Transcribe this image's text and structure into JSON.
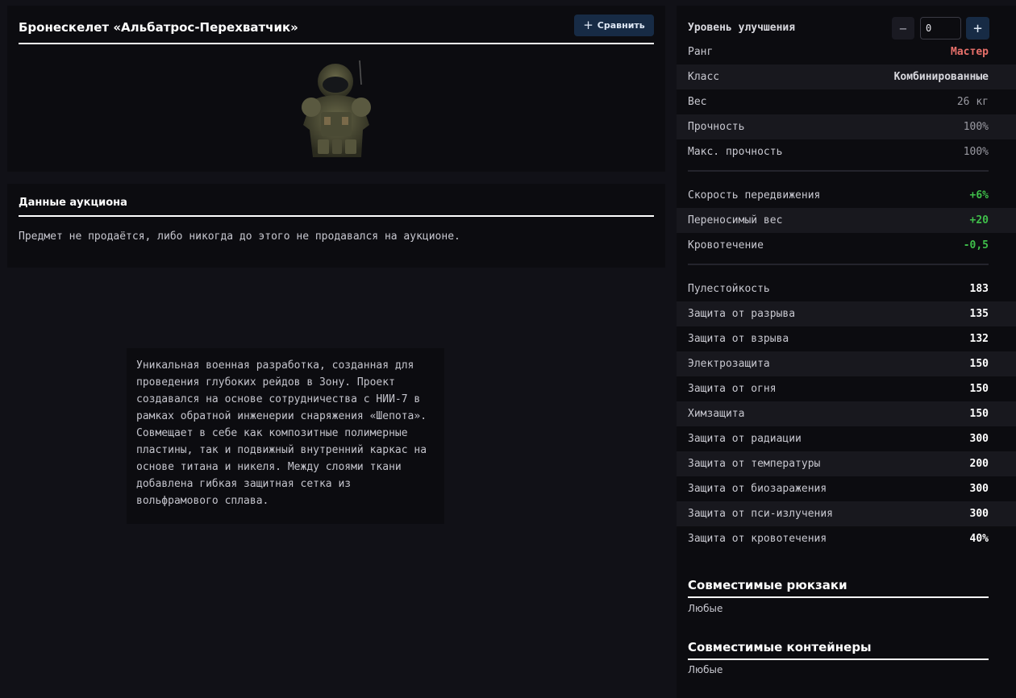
{
  "item": {
    "title": "Бронескелет «Альбатрос-Перехватчик»",
    "compare_label": "Сравнить",
    "image_icon": "armor-suit-image"
  },
  "auction": {
    "title": "Данные аукциона",
    "text": "Предмет не продаётся, либо никогда до этого не продавался на аукционе."
  },
  "description": "Уникальная военная разработка, созданная для проведения глубоких рейдов в Зону. Проект создавался на основе сотрудничества с НИИ-7 в рамках обратной инженерии снаряжения «Шепота». Совмещает в себе как композитные полимерные пластины, так и подвижный внутренний каркас на основе титана и никеля. Между слоями ткани добавлена гибкая защитная сетка из вольфрамового сплава.",
  "upgrade": {
    "label": "Уровень улучшения",
    "minus": "−",
    "plus": "+",
    "value": "0"
  },
  "stats": {
    "group1": [
      {
        "label": "Ранг",
        "value": "Мастер"
      },
      {
        "label": "Класс",
        "value": "Комбинированные"
      },
      {
        "label": "Вес",
        "value": "26 кг"
      },
      {
        "label": "Прочность",
        "value": "100%"
      },
      {
        "label": "Макс. прочность",
        "value": "100%"
      }
    ],
    "group2": [
      {
        "label": "Скорость передвижения",
        "value": "+6%"
      },
      {
        "label": "Переносимый вес",
        "value": "+20"
      },
      {
        "label": "Кровотечение",
        "value": "-0,5"
      }
    ],
    "group3": [
      {
        "label": "Пулестойкость",
        "value": "183"
      },
      {
        "label": "Защита от разрыва",
        "value": "135"
      },
      {
        "label": "Защита от взрыва",
        "value": "132"
      },
      {
        "label": "Электрозащита",
        "value": "150"
      },
      {
        "label": "Защита от огня",
        "value": "150"
      },
      {
        "label": "Химзащита",
        "value": "150"
      },
      {
        "label": "Защита от радиации",
        "value": "300"
      },
      {
        "label": "Защита от температуры",
        "value": "200"
      },
      {
        "label": "Защита от биозаражения",
        "value": "300"
      },
      {
        "label": "Защита от пси-излучения",
        "value": "300"
      },
      {
        "label": "Защита от кровотечения",
        "value": "40%"
      }
    ]
  },
  "compat": {
    "backpacks_title": "Совместимые рюкзаки",
    "backpacks_value": "Любые",
    "containers_title": "Совместимые контейнеры",
    "containers_value": "Любые"
  },
  "colors": {
    "accent": "#172b45",
    "rank": "#e8706a",
    "positive": "#3fbf4a"
  }
}
